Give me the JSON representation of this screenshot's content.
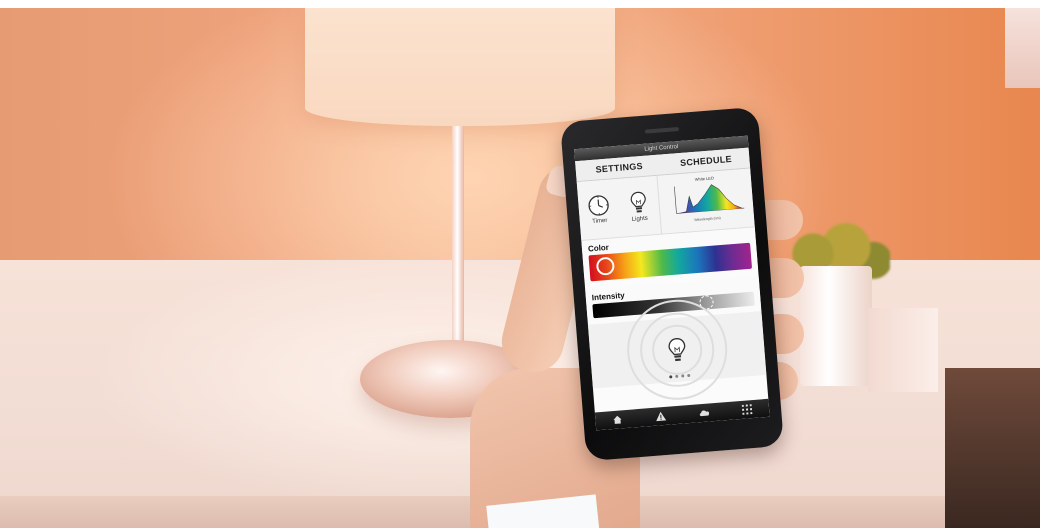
{
  "app": {
    "title": "Light Control"
  },
  "tabs": [
    {
      "label": "SETTINGS"
    },
    {
      "label": "SCHEDULE"
    }
  ],
  "tiles": {
    "timer": {
      "label": "Timer",
      "icon": "clock-icon"
    },
    "lights": {
      "label": "Lights",
      "icon": "lightbulb-icon"
    },
    "spectrum": {
      "title": "White LED",
      "xlabel": "Wavelength (nm)"
    }
  },
  "color": {
    "label": "Color",
    "knob_position": 0.05
  },
  "intensity": {
    "label": "Intensity",
    "level": 0.72
  },
  "bulb": {
    "icon": "lightbulb-icon",
    "page_count": 4,
    "active_page": 0
  },
  "nav": [
    {
      "icon": "home-icon"
    },
    {
      "icon": "warning-icon"
    },
    {
      "icon": "cloud-icon"
    },
    {
      "icon": "grid-icon"
    }
  ],
  "colors": {
    "titlebar": "#3f3f3f",
    "screen_bg": "#fbfbfb",
    "nav_bg": "#1a1a1a"
  }
}
